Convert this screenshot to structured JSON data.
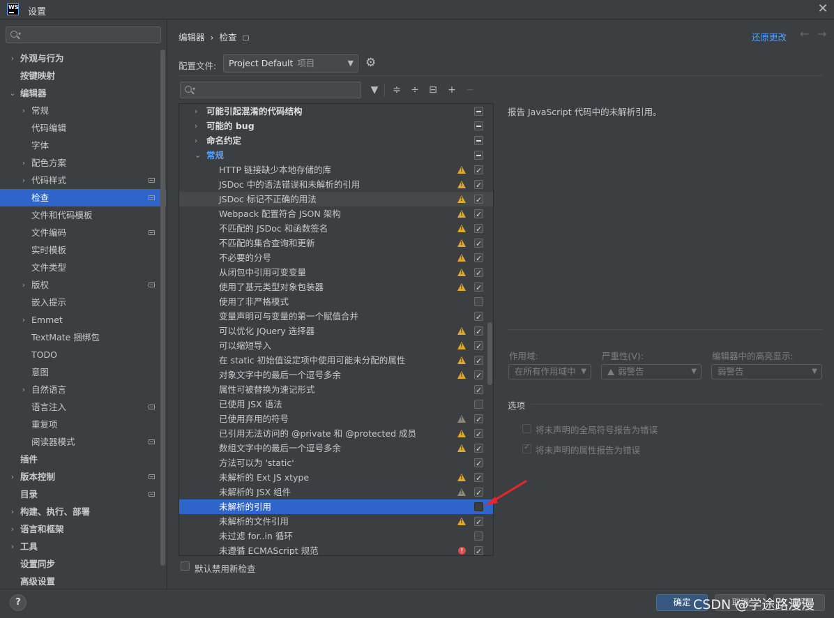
{
  "window": {
    "title": "设置",
    "logo_text": "WS"
  },
  "sidebar": {
    "items": [
      {
        "label": "外观与行为",
        "level": 0,
        "expandable": true,
        "expanded": false,
        "bold": true
      },
      {
        "label": "按键映射",
        "level": 0,
        "expandable": false,
        "bold": true
      },
      {
        "label": "编辑器",
        "level": 0,
        "expandable": true,
        "expanded": true,
        "bold": true
      },
      {
        "label": "常规",
        "level": 1,
        "expandable": true,
        "expanded": false
      },
      {
        "label": "代码编辑",
        "level": 1,
        "expandable": false
      },
      {
        "label": "字体",
        "level": 1,
        "expandable": false
      },
      {
        "label": "配色方案",
        "level": 1,
        "expandable": true,
        "expanded": false
      },
      {
        "label": "代码样式",
        "level": 1,
        "expandable": true,
        "expanded": false,
        "project_icon": true
      },
      {
        "label": "检查",
        "level": 1,
        "expandable": false,
        "selected": true,
        "project_icon": true
      },
      {
        "label": "文件和代码模板",
        "level": 1,
        "expandable": false
      },
      {
        "label": "文件编码",
        "level": 1,
        "expandable": false,
        "project_icon": true
      },
      {
        "label": "实时模板",
        "level": 1,
        "expandable": false
      },
      {
        "label": "文件类型",
        "level": 1,
        "expandable": false
      },
      {
        "label": "版权",
        "level": 1,
        "expandable": true,
        "expanded": false,
        "project_icon": true
      },
      {
        "label": "嵌入提示",
        "level": 1,
        "expandable": false
      },
      {
        "label": "Emmet",
        "level": 1,
        "expandable": true,
        "expanded": false
      },
      {
        "label": "TextMate 捆绑包",
        "level": 1,
        "expandable": false
      },
      {
        "label": "TODO",
        "level": 1,
        "expandable": false
      },
      {
        "label": "意图",
        "level": 1,
        "expandable": false
      },
      {
        "label": "自然语言",
        "level": 1,
        "expandable": true,
        "expanded": false
      },
      {
        "label": "语言注入",
        "level": 1,
        "expandable": false,
        "project_icon": true
      },
      {
        "label": "重复项",
        "level": 1,
        "expandable": false
      },
      {
        "label": "阅读器模式",
        "level": 1,
        "expandable": false,
        "project_icon": true
      },
      {
        "label": "插件",
        "level": 0,
        "expandable": false,
        "bold": true
      },
      {
        "label": "版本控制",
        "level": 0,
        "expandable": true,
        "expanded": false,
        "bold": true,
        "project_icon": true
      },
      {
        "label": "目录",
        "level": 0,
        "expandable": false,
        "bold": true,
        "project_icon": true
      },
      {
        "label": "构建、执行、部署",
        "level": 0,
        "expandable": true,
        "expanded": false,
        "bold": true
      },
      {
        "label": "语言和框架",
        "level": 0,
        "expandable": true,
        "expanded": false,
        "bold": true
      },
      {
        "label": "工具",
        "level": 0,
        "expandable": true,
        "expanded": false,
        "bold": true
      },
      {
        "label": "设置同步",
        "level": 0,
        "expandable": false,
        "bold": true
      },
      {
        "label": "高级设置",
        "level": 0,
        "expandable": false,
        "bold": true
      }
    ]
  },
  "header": {
    "breadcrumb": [
      "编辑器",
      "检查"
    ],
    "breadcrumb_sep": "›",
    "revert_label": "还原更改",
    "profile_label": "配置文件:",
    "profile_value": "Project Default",
    "profile_scope": "项目"
  },
  "inspections": [
    {
      "label": "可能引起混淆的代码结构",
      "type": "group",
      "expanded": false,
      "check": "mixed"
    },
    {
      "label": "可能的 bug",
      "type": "group",
      "expanded": false,
      "check": "mixed"
    },
    {
      "label": "命名约定",
      "type": "group",
      "expanded": false,
      "check": "mixed"
    },
    {
      "label": "常规",
      "type": "group",
      "expanded": true,
      "check": "mixed"
    },
    {
      "label": "HTTP 链接缺少本地存储的库",
      "type": "item",
      "severity": "warning",
      "check": "on"
    },
    {
      "label": "JSDoc 中的语法错误和未解析的引用",
      "type": "item",
      "severity": "warning",
      "check": "on"
    },
    {
      "label": "JSDoc 标记不正确的用法",
      "type": "item",
      "severity": "warning",
      "check": "on",
      "hover": true
    },
    {
      "label": "Webpack 配置符合 JSON 架构",
      "type": "item",
      "severity": "warning",
      "check": "on"
    },
    {
      "label": "不匹配的 JSDoc 和函数签名",
      "type": "item",
      "severity": "warning",
      "check": "on"
    },
    {
      "label": "不匹配的集合查询和更新",
      "type": "item",
      "severity": "warning",
      "check": "on"
    },
    {
      "label": "不必要的分号",
      "type": "item",
      "severity": "warning",
      "check": "on"
    },
    {
      "label": "从闭包中引用可变变量",
      "type": "item",
      "severity": "warning",
      "check": "on"
    },
    {
      "label": "使用了基元类型对象包装器",
      "type": "item",
      "severity": "warning",
      "check": "on"
    },
    {
      "label": "使用了非严格模式",
      "type": "item",
      "severity": "none",
      "check": "off"
    },
    {
      "label": "变量声明可与变量的第一个赋值合并",
      "type": "item",
      "severity": "none",
      "check": "on"
    },
    {
      "label": "可以优化 JQuery 选择器",
      "type": "item",
      "severity": "warning",
      "check": "on"
    },
    {
      "label": "可以缩短导入",
      "type": "item",
      "severity": "warning",
      "check": "on"
    },
    {
      "label": "在 static 初始值设定项中使用可能未分配的属性",
      "type": "item",
      "severity": "warning",
      "check": "on"
    },
    {
      "label": "对象文字中的最后一个逗号多余",
      "type": "item",
      "severity": "warning",
      "check": "on"
    },
    {
      "label": "属性可被替换为速记形式",
      "type": "item",
      "severity": "none",
      "check": "on"
    },
    {
      "label": "已使用 JSX 语法",
      "type": "item",
      "severity": "none",
      "check": "off"
    },
    {
      "label": "已使用弃用的符号",
      "type": "item",
      "severity": "weak",
      "check": "on"
    },
    {
      "label": "已引用无法访问的 @private 和 @protected 成员",
      "type": "item",
      "severity": "warning",
      "check": "on"
    },
    {
      "label": "数组文字中的最后一个逗号多余",
      "type": "item",
      "severity": "warning",
      "check": "on"
    },
    {
      "label": "方法可以为 'static'",
      "type": "item",
      "severity": "none",
      "check": "on"
    },
    {
      "label": "未解析的 Ext JS xtype",
      "type": "item",
      "severity": "warning",
      "check": "on"
    },
    {
      "label": "未解析的 JSX 组件",
      "type": "item",
      "severity": "weak",
      "check": "on"
    },
    {
      "label": "未解析的引用",
      "type": "item",
      "severity": "none",
      "check": "off",
      "selected": true
    },
    {
      "label": "未解析的文件引用",
      "type": "item",
      "severity": "warning",
      "check": "on"
    },
    {
      "label": "未过滤 for..in 循环",
      "type": "item",
      "severity": "none",
      "check": "off"
    },
    {
      "label": "未遵循 ECMAScript 规范",
      "type": "item",
      "severity": "error",
      "check": "on"
    }
  ],
  "footer_list": {
    "default_disable_label": "默认禁用新检查"
  },
  "details": {
    "description": "报告 JavaScript 代码中的未解析引用。",
    "scope_label": "作用域:",
    "scope_value": "在所有作用域中",
    "severity_label": "严重性(V):",
    "severity_value": "弱警告",
    "highlight_label": "编辑器中的高亮显示:",
    "highlight_value": "弱警告",
    "options_title": "选项",
    "option1": "将未声明的全局符号报告为错误",
    "option1_checked": false,
    "option2": "将未声明的属性报告为错误",
    "option2_checked": true
  },
  "bottom": {
    "help": "?",
    "ok": "确定",
    "cancel": "取消",
    "apply": "应用",
    "watermark": "CSDN @学途路漫漫"
  },
  "colors": {
    "accent": "#2f65ca",
    "link": "#589df6",
    "warning": "#e0a92a",
    "error": "#e04a4a",
    "background": "#3c3f41",
    "annotation_arrow": "#e8262a"
  }
}
